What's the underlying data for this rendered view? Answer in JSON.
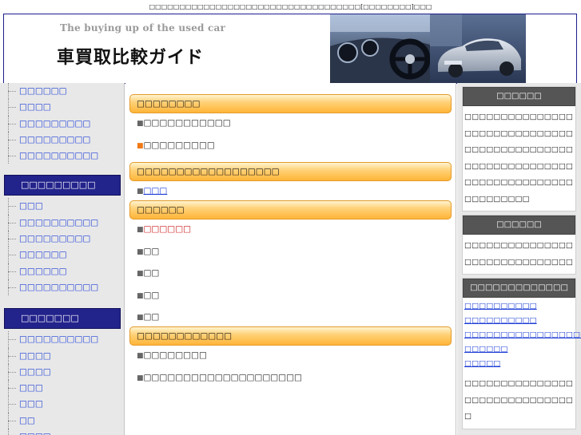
{
  "topline": "□□□□□□□□□□□□□□□□□□□□□□□□□□□□□□□□□□□[□□□□□□□□]□□□",
  "header": {
    "tagline": "The buying up of the used car",
    "title": "車買取比較ガイド"
  },
  "left_nav": {
    "group1": [
      "□□□□□□",
      "□□□□",
      "□□□□□□□□□",
      "□□□□□□□□□",
      "□□□□□□□□□□"
    ],
    "section2_title": "□□□□□□□□□",
    "group2": [
      "□□□",
      "□□□□□□□□□□",
      "□□□□□□□□□",
      "□□□□□□",
      "□□□□□□",
      "□□□□□□□□□□"
    ],
    "section3_title": "□□□□□□□",
    "group3": [
      "□□□□□□□□□□",
      "□□□□",
      "□□□□",
      "□□□",
      "□□□",
      "□□",
      "□□□□"
    ]
  },
  "main": {
    "sections": [
      {
        "title": "□□□□□□□□",
        "items": [
          {
            "text": "□□□□□□□□□□□",
            "style": "plain",
            "bullet": "gray"
          },
          {
            "text": "□□□□□□□□□",
            "style": "plain",
            "bullet": "orange"
          }
        ]
      },
      {
        "title": "□□□□□□□□□□□□□□□□□□",
        "items": [
          {
            "text": "□□□",
            "style": "link",
            "bullet": "gray"
          }
        ]
      },
      {
        "title": "□□□□□□",
        "items": [
          {
            "text": "□□□□□□",
            "style": "red",
            "bullet": "gray"
          },
          {
            "text": "□□",
            "style": "plain",
            "bullet": "gray"
          },
          {
            "text": "□□",
            "style": "plain",
            "bullet": "gray"
          },
          {
            "text": "□□",
            "style": "plain",
            "bullet": "gray"
          },
          {
            "text": "□□",
            "style": "plain",
            "bullet": "gray"
          }
        ]
      },
      {
        "title": "□□□□□□□□□□□□",
        "items": [
          {
            "text": "□□□□□□□□",
            "style": "plain",
            "bullet": "gray"
          },
          {
            "text": "□□□□□□□□□□□□□□□□□□□□",
            "style": "plain",
            "bullet": "gray"
          }
        ]
      }
    ],
    "bullet_glyph": "■"
  },
  "right": {
    "box1": {
      "title": "□□□□□□",
      "text": "□□□□□□□□□□□□□□□□□□□□□□□□□□□□□□□□□□□□□□□□□□□□□□□□□□□□□□□□□□□□□□□□□□□□□□□□□□□□□□□□□□□□"
    },
    "box2": {
      "title": "□□□□□□",
      "text": "□□□□□□□□□□□□□□□□□□□□□□□□□□□□□□"
    },
    "box3": {
      "title": "□□□□□□□□□□□□□",
      "links": [
        "□□□□□□□□□□",
        "□□□□□□□□□□",
        "□□□□□□□□□□□□□□□□□□□□",
        "□□□□□□",
        "□□□□□"
      ],
      "text": "□□□□□□□□□□□□□□□□□□□□□□□□□□□□□□□"
    }
  },
  "colors": {
    "nav_heading": "#23238c",
    "link": "#1a3bd6",
    "bar_border": "#e39a2a",
    "bar_fill": "#ffb538",
    "right_heading": "#555555",
    "accent_red": "#cc1111",
    "bullet_orange": "#f07a18"
  }
}
